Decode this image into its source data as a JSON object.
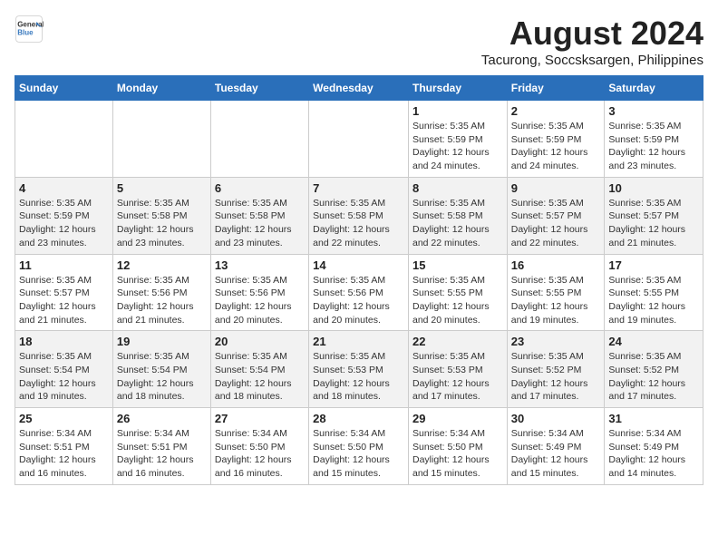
{
  "header": {
    "logo_line1": "General",
    "logo_line2": "Blue",
    "title": "August 2024",
    "subtitle": "Tacurong, Soccsksargen, Philippines"
  },
  "days_of_week": [
    "Sunday",
    "Monday",
    "Tuesday",
    "Wednesday",
    "Thursday",
    "Friday",
    "Saturday"
  ],
  "weeks": [
    [
      {
        "day": "",
        "info": ""
      },
      {
        "day": "",
        "info": ""
      },
      {
        "day": "",
        "info": ""
      },
      {
        "day": "",
        "info": ""
      },
      {
        "day": "1",
        "info": "Sunrise: 5:35 AM\nSunset: 5:59 PM\nDaylight: 12 hours and 24 minutes."
      },
      {
        "day": "2",
        "info": "Sunrise: 5:35 AM\nSunset: 5:59 PM\nDaylight: 12 hours and 24 minutes."
      },
      {
        "day": "3",
        "info": "Sunrise: 5:35 AM\nSunset: 5:59 PM\nDaylight: 12 hours and 23 minutes."
      }
    ],
    [
      {
        "day": "4",
        "info": "Sunrise: 5:35 AM\nSunset: 5:59 PM\nDaylight: 12 hours and 23 minutes."
      },
      {
        "day": "5",
        "info": "Sunrise: 5:35 AM\nSunset: 5:58 PM\nDaylight: 12 hours and 23 minutes."
      },
      {
        "day": "6",
        "info": "Sunrise: 5:35 AM\nSunset: 5:58 PM\nDaylight: 12 hours and 23 minutes."
      },
      {
        "day": "7",
        "info": "Sunrise: 5:35 AM\nSunset: 5:58 PM\nDaylight: 12 hours and 22 minutes."
      },
      {
        "day": "8",
        "info": "Sunrise: 5:35 AM\nSunset: 5:58 PM\nDaylight: 12 hours and 22 minutes."
      },
      {
        "day": "9",
        "info": "Sunrise: 5:35 AM\nSunset: 5:57 PM\nDaylight: 12 hours and 22 minutes."
      },
      {
        "day": "10",
        "info": "Sunrise: 5:35 AM\nSunset: 5:57 PM\nDaylight: 12 hours and 21 minutes."
      }
    ],
    [
      {
        "day": "11",
        "info": "Sunrise: 5:35 AM\nSunset: 5:57 PM\nDaylight: 12 hours and 21 minutes."
      },
      {
        "day": "12",
        "info": "Sunrise: 5:35 AM\nSunset: 5:56 PM\nDaylight: 12 hours and 21 minutes."
      },
      {
        "day": "13",
        "info": "Sunrise: 5:35 AM\nSunset: 5:56 PM\nDaylight: 12 hours and 20 minutes."
      },
      {
        "day": "14",
        "info": "Sunrise: 5:35 AM\nSunset: 5:56 PM\nDaylight: 12 hours and 20 minutes."
      },
      {
        "day": "15",
        "info": "Sunrise: 5:35 AM\nSunset: 5:55 PM\nDaylight: 12 hours and 20 minutes."
      },
      {
        "day": "16",
        "info": "Sunrise: 5:35 AM\nSunset: 5:55 PM\nDaylight: 12 hours and 19 minutes."
      },
      {
        "day": "17",
        "info": "Sunrise: 5:35 AM\nSunset: 5:55 PM\nDaylight: 12 hours and 19 minutes."
      }
    ],
    [
      {
        "day": "18",
        "info": "Sunrise: 5:35 AM\nSunset: 5:54 PM\nDaylight: 12 hours and 19 minutes."
      },
      {
        "day": "19",
        "info": "Sunrise: 5:35 AM\nSunset: 5:54 PM\nDaylight: 12 hours and 18 minutes."
      },
      {
        "day": "20",
        "info": "Sunrise: 5:35 AM\nSunset: 5:54 PM\nDaylight: 12 hours and 18 minutes."
      },
      {
        "day": "21",
        "info": "Sunrise: 5:35 AM\nSunset: 5:53 PM\nDaylight: 12 hours and 18 minutes."
      },
      {
        "day": "22",
        "info": "Sunrise: 5:35 AM\nSunset: 5:53 PM\nDaylight: 12 hours and 17 minutes."
      },
      {
        "day": "23",
        "info": "Sunrise: 5:35 AM\nSunset: 5:52 PM\nDaylight: 12 hours and 17 minutes."
      },
      {
        "day": "24",
        "info": "Sunrise: 5:35 AM\nSunset: 5:52 PM\nDaylight: 12 hours and 17 minutes."
      }
    ],
    [
      {
        "day": "25",
        "info": "Sunrise: 5:34 AM\nSunset: 5:51 PM\nDaylight: 12 hours and 16 minutes."
      },
      {
        "day": "26",
        "info": "Sunrise: 5:34 AM\nSunset: 5:51 PM\nDaylight: 12 hours and 16 minutes."
      },
      {
        "day": "27",
        "info": "Sunrise: 5:34 AM\nSunset: 5:50 PM\nDaylight: 12 hours and 16 minutes."
      },
      {
        "day": "28",
        "info": "Sunrise: 5:34 AM\nSunset: 5:50 PM\nDaylight: 12 hours and 15 minutes."
      },
      {
        "day": "29",
        "info": "Sunrise: 5:34 AM\nSunset: 5:50 PM\nDaylight: 12 hours and 15 minutes."
      },
      {
        "day": "30",
        "info": "Sunrise: 5:34 AM\nSunset: 5:49 PM\nDaylight: 12 hours and 15 minutes."
      },
      {
        "day": "31",
        "info": "Sunrise: 5:34 AM\nSunset: 5:49 PM\nDaylight: 12 hours and 14 minutes."
      }
    ]
  ]
}
